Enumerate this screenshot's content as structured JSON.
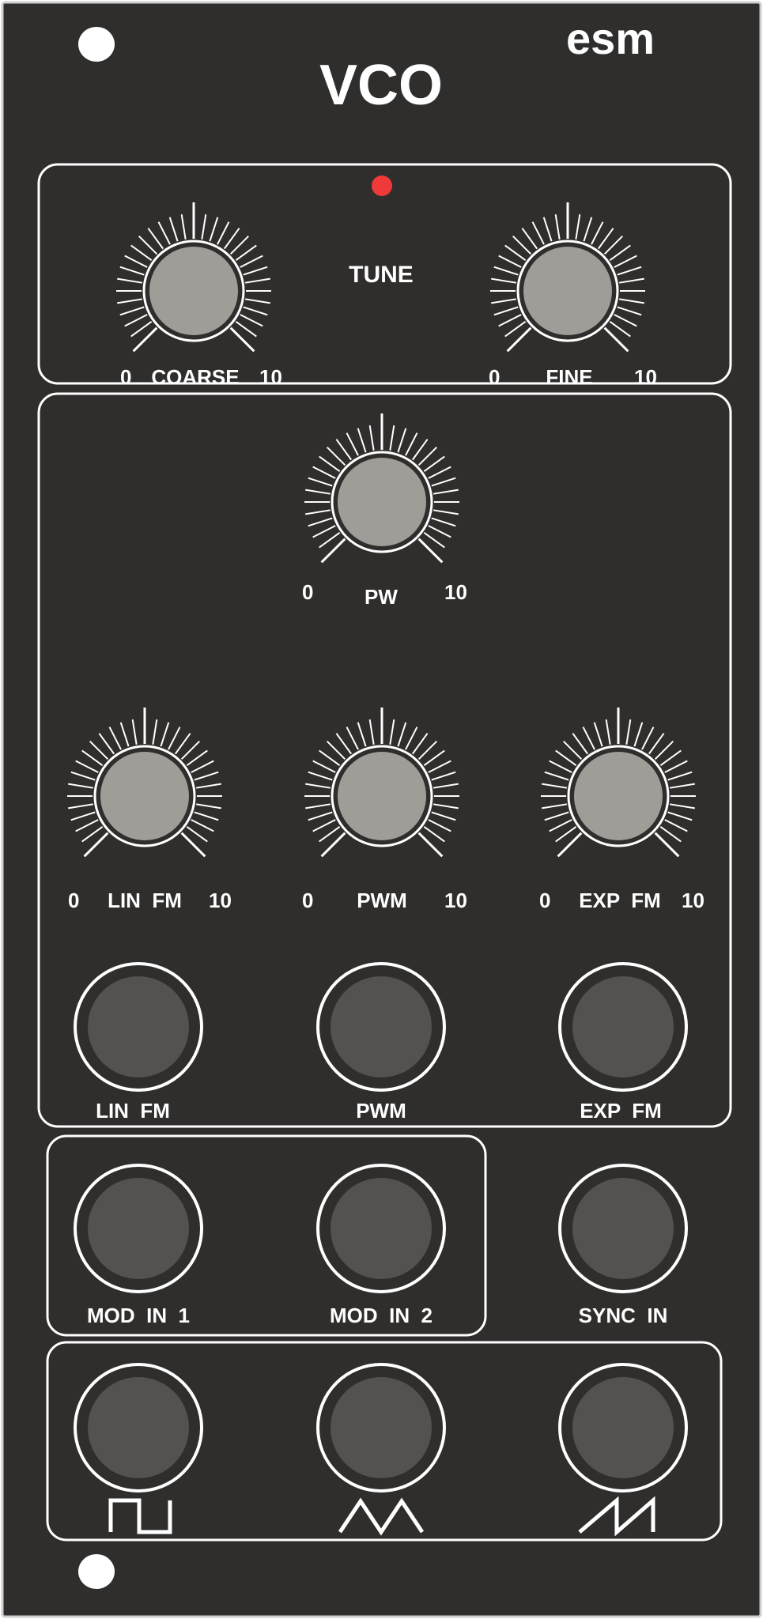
{
  "module": {
    "brand": "esm",
    "title": "VCO"
  },
  "tune_section": {
    "label": "TUNE",
    "knobs": [
      {
        "id": "coarse",
        "label": "COARSE",
        "min_label": "0",
        "max_label": "10"
      },
      {
        "id": "fine",
        "label": "FINE",
        "min_label": "0",
        "max_label": "10"
      }
    ]
  },
  "mod_section": {
    "knobs": [
      {
        "id": "pw",
        "label": "PW",
        "min_label": "0",
        "max_label": "10"
      },
      {
        "id": "lin-fm",
        "label": "LIN  FM",
        "min_label": "0",
        "max_label": "10"
      },
      {
        "id": "pwm",
        "label": "PWM",
        "min_label": "0",
        "max_label": "10"
      },
      {
        "id": "exp-fm",
        "label": "EXP  FM",
        "min_label": "0",
        "max_label": "10"
      }
    ],
    "jacks": [
      {
        "id": "lin-fm",
        "label": "LIN  FM"
      },
      {
        "id": "pwm",
        "label": "PWM"
      },
      {
        "id": "exp-fm",
        "label": "EXP  FM"
      }
    ]
  },
  "inputs": {
    "jacks": [
      {
        "id": "mod-in-1",
        "label": "MOD  IN  1"
      },
      {
        "id": "mod-in-2",
        "label": "MOD  IN  2"
      },
      {
        "id": "sync-in",
        "label": "SYNC  IN"
      }
    ]
  },
  "outputs": {
    "jacks": [
      {
        "id": "square",
        "icon": "square-wave-icon"
      },
      {
        "id": "triangle",
        "icon": "triangle-wave-icon"
      },
      {
        "id": "sawtooth",
        "icon": "sawtooth-wave-icon"
      }
    ]
  },
  "colors": {
    "panel": "#302e2c",
    "knob": "#a09d98",
    "jack": "#545150",
    "led": "#f03a3a",
    "line": "#ffffff"
  }
}
